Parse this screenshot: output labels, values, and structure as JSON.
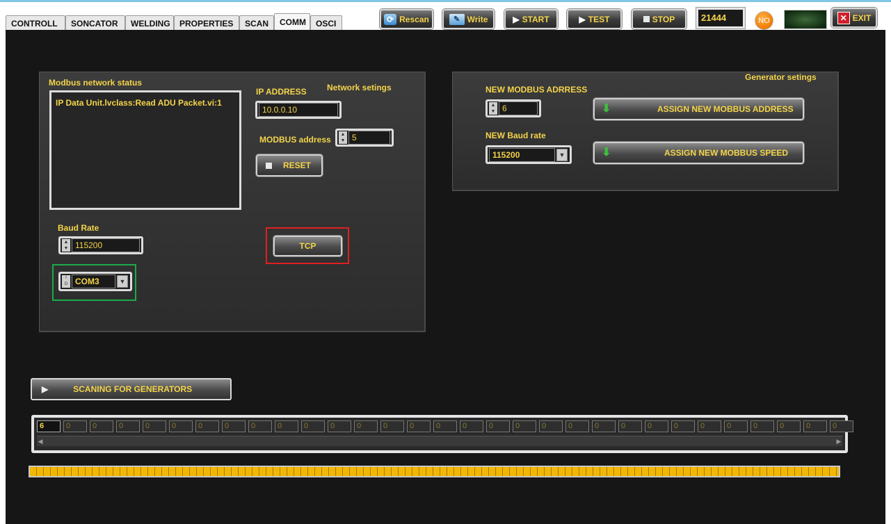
{
  "tabs": [
    {
      "label": "CONTROLL",
      "active": false
    },
    {
      "label": "SONCATOR",
      "active": false
    },
    {
      "label": "WELDING",
      "active": false
    },
    {
      "label": "PROPERTIES",
      "active": false
    },
    {
      "label": "SCAN",
      "active": false
    },
    {
      "label": "COMM",
      "active": true
    },
    {
      "label": "OSCI",
      "active": false
    }
  ],
  "toolbar": {
    "rescan_label": "Rescan",
    "write_label": "Write",
    "start_label": "START",
    "test_label": "TEST",
    "stop_label": "STOP",
    "counter_value": "21444",
    "status_led_label": "NO",
    "exit_label": "EXIT"
  },
  "network_panel": {
    "status_title": "Modbus network status",
    "status_text": "IP Data Unit.lvclass:Read ADU Packet.vi:1",
    "ip_label": "IP ADDRESS",
    "settings_title": "Network setings",
    "ip_value": "10.0.0.10",
    "modbus_label": "MODBUS address",
    "modbus_value": "5",
    "reset_label": "RESET",
    "baud_label": "Baud Rate",
    "baud_value": "115200",
    "mode_button_label": "TCP",
    "com_port_value": "COM3"
  },
  "generator_panel": {
    "title": "Generator setings",
    "new_addr_label": "NEW MODBUS ADRRESS",
    "new_addr_value": "6",
    "assign_addr_label": "ASSIGN NEW MOBBUS ADDRESS",
    "new_baud_label": "NEW Baud rate",
    "new_baud_value": "115200",
    "assign_speed_label": "ASSIGN NEW MOBBUS SPEED"
  },
  "scan": {
    "button_label": "SCANING FOR GENERATORS",
    "addresses": [
      "6",
      "0",
      "0",
      "0",
      "0",
      "0",
      "0",
      "0",
      "0",
      "0",
      "0",
      "0",
      "0",
      "0",
      "0",
      "0",
      "0",
      "0",
      "0",
      "0",
      "0",
      "0",
      "0",
      "0",
      "0",
      "0",
      "0",
      "0",
      "0",
      "0",
      "0"
    ],
    "progress_fraction": 1.0
  },
  "colors": {
    "panel_text": "#f4d44a",
    "background": "#161616",
    "highlight_red": "#e02020",
    "highlight_green": "#1cab48"
  }
}
